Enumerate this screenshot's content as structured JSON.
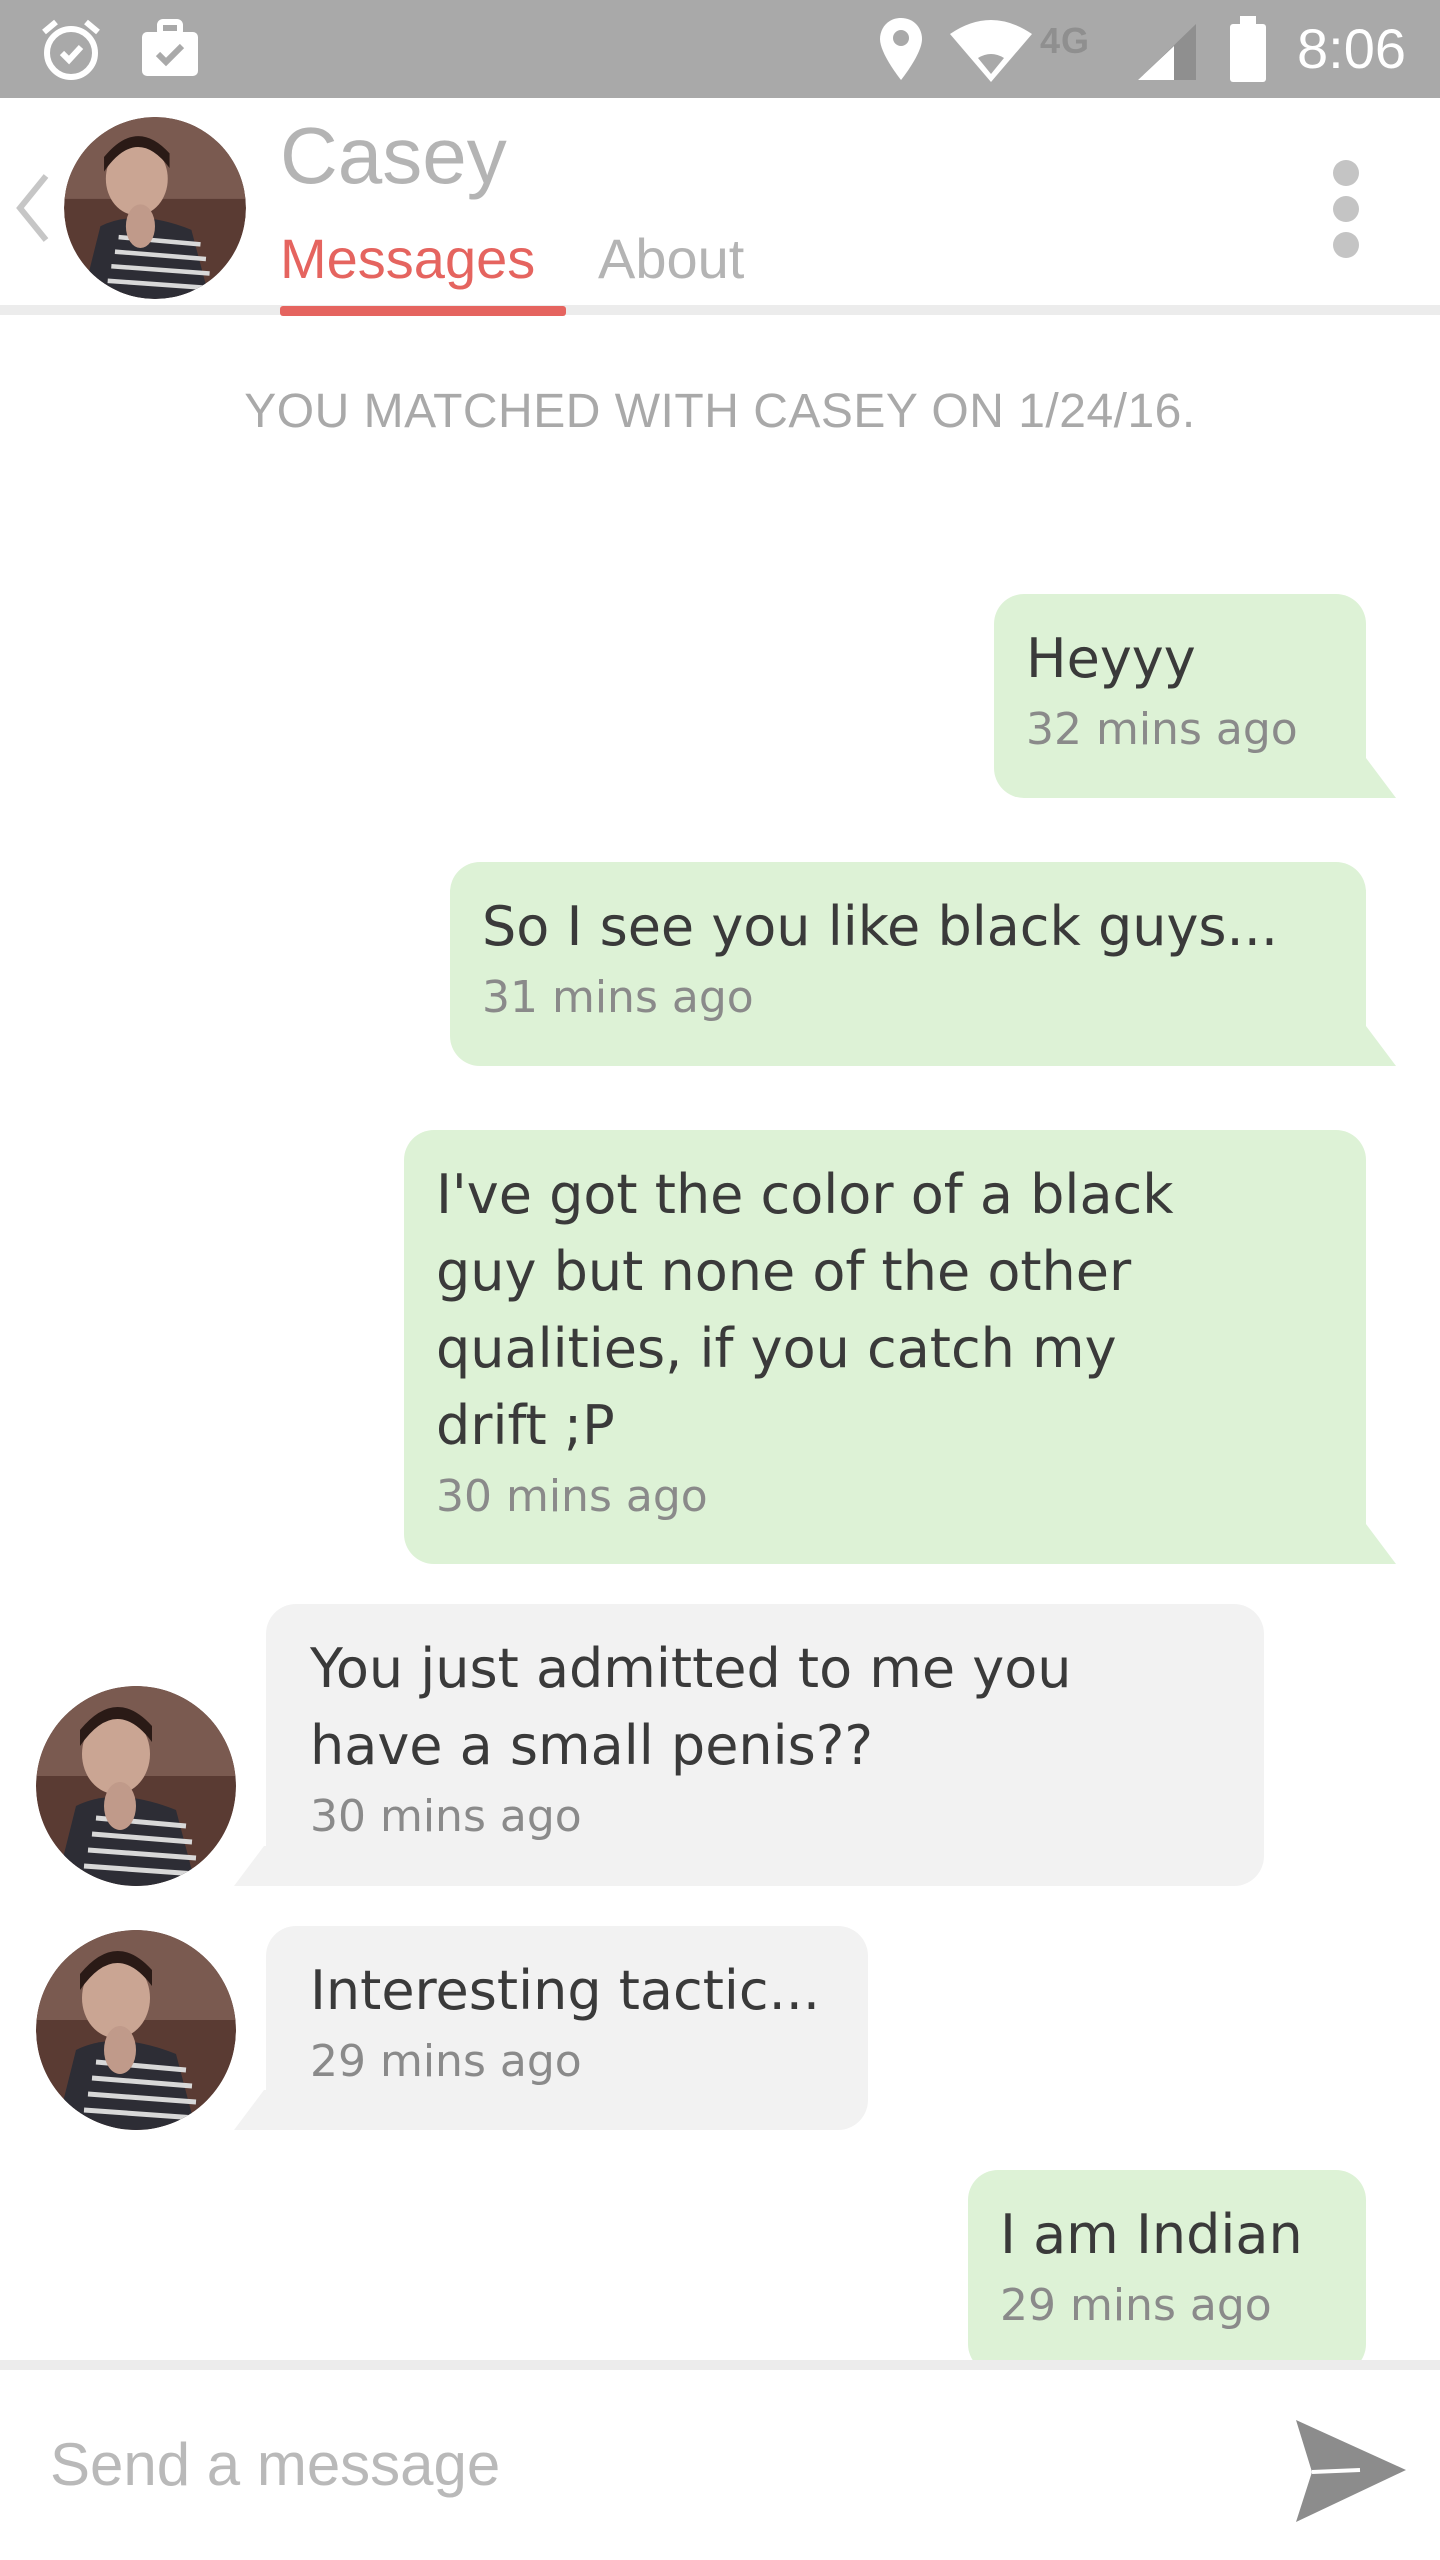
{
  "status_bar": {
    "time": "8:06",
    "network": "4G",
    "icons": [
      "alarm-icon",
      "briefcase-icon",
      "location-icon",
      "wifi-icon",
      "signal-icon",
      "battery-icon"
    ]
  },
  "header": {
    "contact_name": "Casey",
    "tabs": {
      "messages": "Messages",
      "about": "About"
    },
    "active_tab": "messages",
    "accent_color": "#e5645f"
  },
  "match_notice": "YOU MATCHED WITH CASEY ON 1/24/16.",
  "messages": [
    {
      "from": "me",
      "text": "Heyyy",
      "time": "32 mins ago"
    },
    {
      "from": "me",
      "text": "So I see you like black guys...",
      "time": "31 mins ago"
    },
    {
      "from": "me",
      "text": "I've got the color of a black\nguy but none of the other\nqualities, if you catch my\ndrift ;P",
      "time": "30 mins ago"
    },
    {
      "from": "them",
      "text": "You just admitted to me you\nhave a small penis??",
      "time": "30 mins ago"
    },
    {
      "from": "them",
      "text": "Interesting tactic...",
      "time": "29 mins ago"
    },
    {
      "from": "me",
      "text": "I am Indian",
      "time": "29 mins ago"
    }
  ],
  "composer": {
    "placeholder": "Send a message"
  },
  "colors": {
    "my_bubble": "#ddf2d6",
    "their_bubble": "#f2f2f2",
    "status_bar": "#a9a9a9"
  }
}
